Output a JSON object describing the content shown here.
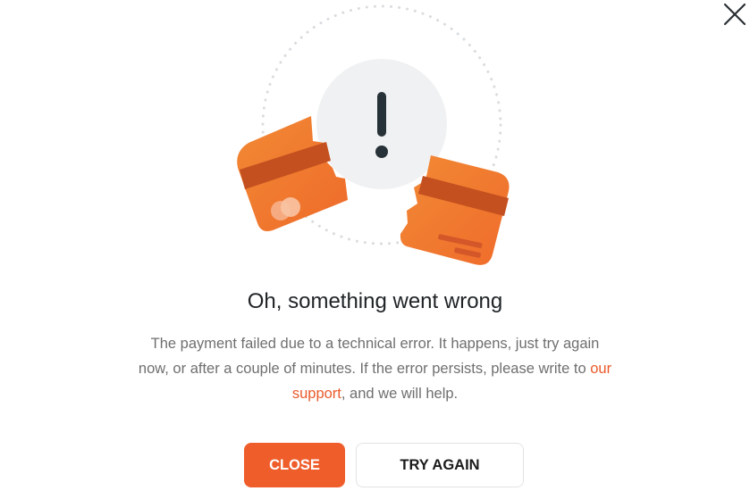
{
  "dialog": {
    "title": "Oh, something went wrong",
    "message_part1": "The payment failed due to a technical error. It happens, just try again now, or after a couple of minutes. If the error persists, please write to ",
    "support_link": "our support",
    "message_part2": ", and we will help.",
    "close_button": "CLOSE",
    "try_again_button": "TRY AGAIN",
    "dismiss_icon": "close-x-icon",
    "illustration_icon": "broken-card-alert-icon"
  },
  "colors": {
    "accent": "#ef5d2b",
    "link": "#ea5a2b",
    "card_orange": "#f07a2e",
    "card_stripe": "#c4501f",
    "alert_circle": "#f0f1f2",
    "text_dark": "#1f2326",
    "text_muted": "#6f6f6f"
  }
}
